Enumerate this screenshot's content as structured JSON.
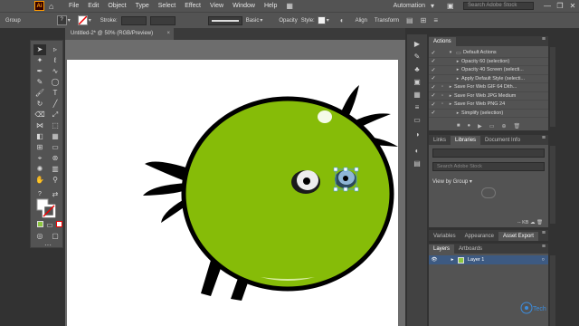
{
  "menubar": {
    "app_logo": "Ai",
    "home_icon": "home-icon",
    "items": [
      "File",
      "Edit",
      "Object",
      "Type",
      "Select",
      "Effect",
      "View",
      "Window",
      "Help"
    ],
    "workspace": "Automation",
    "search_placeholder": "Search Adobe Stock",
    "window_controls": [
      "—",
      "❐",
      "✕"
    ]
  },
  "controlbar": {
    "selection_label": "Group",
    "fill_value": "?",
    "stroke_label": "Stroke:",
    "stroke_style": "Basic",
    "opacity_label": "Opacity",
    "style_label": "Style:",
    "align_label": "Align",
    "transform_label": "Transform"
  },
  "document": {
    "tab_title": "Untitled-2* @ 50% (RGB/Preview)",
    "close_icon": "×"
  },
  "panels": {
    "actions": {
      "tabs": [
        "Actions"
      ],
      "items": [
        {
          "label": "Default Actions",
          "level": 0
        },
        {
          "label": "Opacity 60 (selection)",
          "level": 1
        },
        {
          "label": "Opacity 40 Screen (selecti...",
          "level": 1
        },
        {
          "label": "Apply Default Style (selecti...",
          "level": 1
        },
        {
          "label": "Save For Web GIF 64 Dith...",
          "level": 1
        },
        {
          "label": "Save For Web JPG Medium",
          "level": 1
        },
        {
          "label": "Save For Web PNG 24",
          "level": 1
        },
        {
          "label": "Simplify (selection)",
          "level": 1
        }
      ]
    },
    "libraries": {
      "tabs": [
        "Links",
        "Libraries",
        "Document Info"
      ],
      "search_placeholder": "Search Adobe Stock",
      "view_by": "View by Group",
      "size_label": "-- KB"
    },
    "variables": {
      "tabs": [
        "Variables",
        "Appearance",
        "Asset Export"
      ]
    },
    "layers": {
      "tabs": [
        "Layers",
        "Artboards"
      ],
      "layer_name": "Layer 1"
    }
  },
  "artwork": {
    "body_color": "#86bc08",
    "outline_color": "#000000"
  },
  "watermark": "Tech"
}
